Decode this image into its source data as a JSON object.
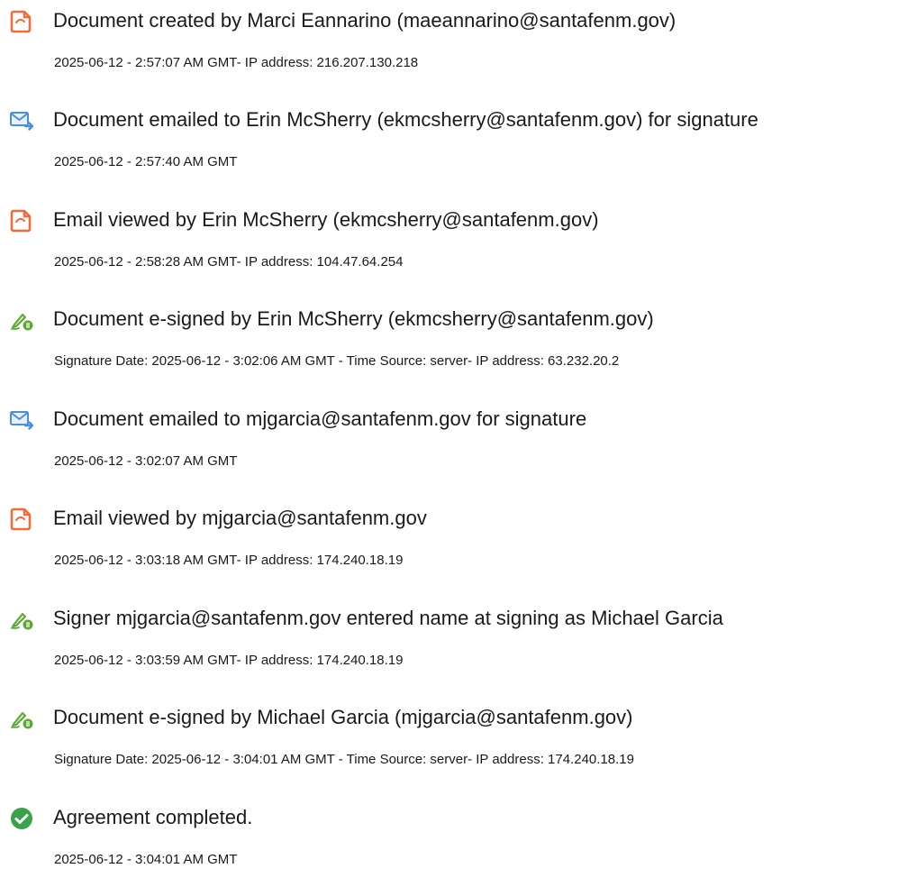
{
  "colors": {
    "document_icon": "#f26b3a",
    "email_icon": "#4a90d9",
    "signature_icon": "#5aa832",
    "completed_icon": "#3aa34a",
    "text": "#1a1a1a"
  },
  "events": [
    {
      "icon": "document-icon",
      "title": "Document created by Marci Eannarino (maeannarino@santafenm.gov)",
      "detail": "2025-06-12 - 2:57:07 AM GMT- IP address: 216.207.130.218"
    },
    {
      "icon": "email-icon",
      "title": "Document emailed to Erin McSherry (ekmcsherry@santafenm.gov) for signature",
      "detail": "2025-06-12 - 2:57:40 AM GMT"
    },
    {
      "icon": "document-icon",
      "title": "Email viewed by Erin McSherry (ekmcsherry@santafenm.gov)",
      "detail": "2025-06-12 - 2:58:28 AM GMT- IP address: 104.47.64.254"
    },
    {
      "icon": "signature-icon",
      "title": "Document e-signed by Erin McSherry (ekmcsherry@santafenm.gov)",
      "detail": "Signature Date: 2025-06-12 - 3:02:06 AM GMT - Time Source: server- IP address: 63.232.20.2"
    },
    {
      "icon": "email-icon",
      "title": "Document emailed to mjgarcia@santafenm.gov for signature",
      "detail": "2025-06-12 - 3:02:07 AM GMT"
    },
    {
      "icon": "document-icon",
      "title": "Email viewed by mjgarcia@santafenm.gov",
      "detail": "2025-06-12 - 3:03:18 AM GMT- IP address: 174.240.18.19"
    },
    {
      "icon": "signature-icon",
      "title": "Signer mjgarcia@santafenm.gov entered name at signing as Michael Garcia",
      "detail": "2025-06-12 - 3:03:59 AM GMT- IP address: 174.240.18.19"
    },
    {
      "icon": "signature-icon",
      "title": "Document e-signed by Michael Garcia (mjgarcia@santafenm.gov)",
      "detail": "Signature Date: 2025-06-12 - 3:04:01 AM GMT - Time Source: server- IP address: 174.240.18.19"
    },
    {
      "icon": "checkmark-circle-icon",
      "title": "Agreement completed.",
      "detail": "2025-06-12 - 3:04:01 AM GMT"
    }
  ]
}
